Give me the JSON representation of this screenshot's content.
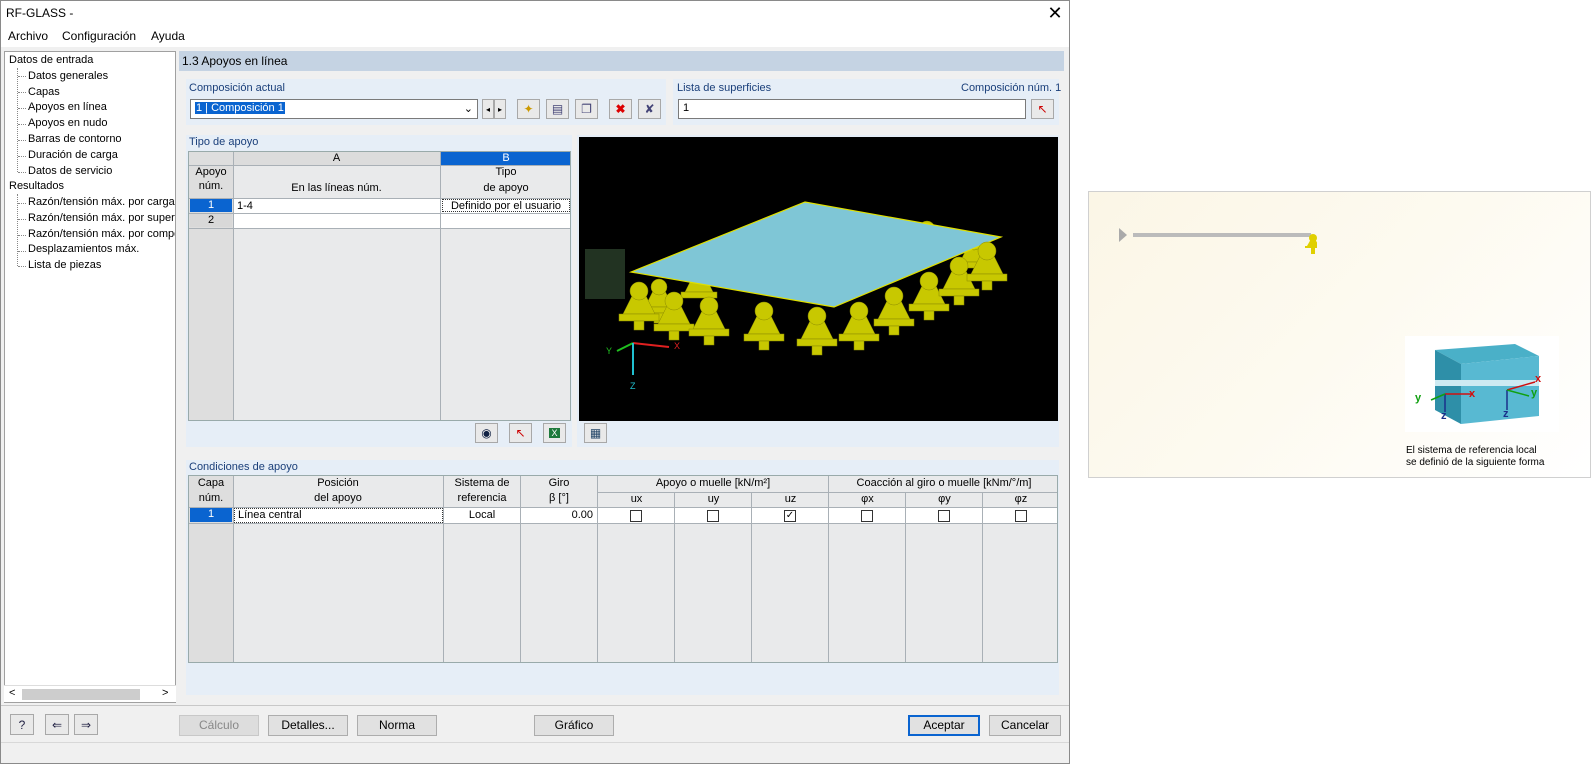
{
  "window": {
    "title": "RF-GLASS -"
  },
  "menu": [
    "Archivo",
    "Configuración",
    "Ayuda"
  ],
  "tree": {
    "groups": [
      {
        "label": "Datos de entrada",
        "items": [
          "Datos generales",
          "Capas",
          "Apoyos en línea",
          "Apoyos en nudo",
          "Barras de contorno",
          "Duración de carga",
          "Datos de servicio"
        ]
      },
      {
        "label": "Resultados",
        "items": [
          "Razón/tensión máx. por carga",
          "Razón/tensión máx. por superf",
          "Razón/tensión máx. por compo",
          "Desplazamientos máx.",
          "Lista de piezas"
        ]
      }
    ]
  },
  "section_title": "1.3 Apoyos en línea",
  "composition": {
    "label": "Composición actual",
    "value": "1 | Composición 1"
  },
  "surfaces": {
    "label": "Lista de superficies",
    "number_label": "Composición núm. 1",
    "value": "1"
  },
  "support_type": {
    "label": "Tipo de apoyo",
    "col_a": "A",
    "col_b": "B",
    "h_num": [
      "Apoyo",
      "núm."
    ],
    "h_a": "En las líneas núm.",
    "h_b": [
      "Tipo",
      "de apoyo"
    ],
    "rows": [
      {
        "num": "1",
        "lines": "1-4",
        "type": "Definido por el usuario"
      },
      {
        "num": "2",
        "lines": "",
        "type": ""
      }
    ]
  },
  "viewport_axes": {
    "x": "X",
    "y": "Y",
    "z": "Z"
  },
  "conditions": {
    "label": "Condiciones de apoyo",
    "h_layer": [
      "Capa",
      "núm."
    ],
    "h_position": [
      "Posición",
      "del apoyo"
    ],
    "h_system": [
      "Sistema de",
      "referencia"
    ],
    "h_rotation": [
      "Giro",
      "β [°]"
    ],
    "h_support": "Apoyo o muelle [kN/m²]",
    "h_restraint": "Coacción al giro o muelle [kNm/°/m]",
    "sub": [
      "ux",
      "uy",
      "uz",
      "φx",
      "φy",
      "φz"
    ],
    "rows": [
      {
        "layer": "1",
        "position": "Línea central",
        "system": "Local",
        "rotation": "0.00",
        "checks": [
          false,
          false,
          true,
          false,
          false,
          false
        ]
      }
    ]
  },
  "buttons": {
    "calc": "Cálculo",
    "details": "Detalles...",
    "norm": "Norma",
    "graphic": "Gráfico",
    "ok": "Aceptar",
    "cancel": "Cancelar"
  },
  "side_panel": {
    "caption_1": "El sistema de referencia local",
    "caption_2": "se definió de la siguiente forma",
    "axes": {
      "x": "x",
      "y": "y",
      "z": "z"
    }
  },
  "colors": {
    "selection": "#0a64d0",
    "section_header": "#c5d3e3",
    "group_bg": "#e6eef7",
    "viewport_bg": "#000000",
    "glass": "#7fc6d6",
    "support": "#d8d800"
  }
}
